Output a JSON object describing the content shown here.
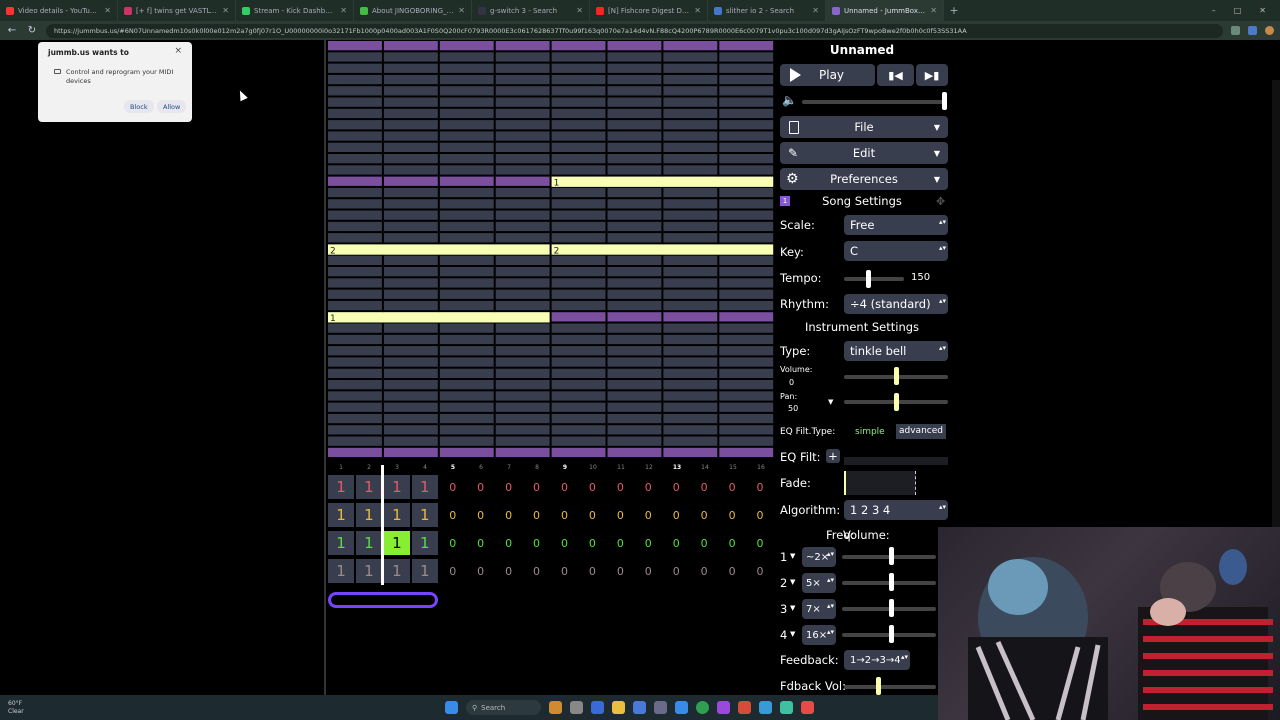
{
  "browser": {
    "tabs": [
      {
        "title": "Video details - YouTube Studio",
        "color": "#ff3333"
      },
      {
        "title": "[+ f] twins get VASTLY JUMPSCARE",
        "color": "#cc3366"
      },
      {
        "title": "Stream - Kick Dashboard",
        "color": "#33cc66"
      },
      {
        "title": "About JINGOBORING_TWINS - Kick",
        "color": "#44bb44"
      },
      {
        "title": "g-switch 3 - Search",
        "color": "#333344"
      },
      {
        "title": "[N] Fishcore Digest Day 1 - GLOVE",
        "color": "#ff2222"
      },
      {
        "title": "slither io 2 - Search",
        "color": "#4477cc"
      },
      {
        "title": "Unnamed - JummBox 2.6",
        "color": "#8866cc"
      }
    ],
    "new_tab": "+",
    "window_controls": [
      "–",
      "□",
      "✕"
    ],
    "url": "https://jummbus.us/#6N07Unnamedm10s0k0l00e012m2a7g0fj07r1O_U00000000i0o32171Fb1000p0400ad003A1F0S0Q200cF0793R0000E3c0617628637Tf0u99f163q0070e7a14d4vN.F88cQ4200P6789R0000E6c0079T1v0pu3c100d097d3gAIjsOzFT9wpoBwe2f0b0h0c0f53SS31AA"
  },
  "popup": {
    "title": "jummb.us wants to",
    "close": "×",
    "message": "Control and reprogram your MIDI devices",
    "block_label": "Block",
    "allow_label": "Allow"
  },
  "pattern": {
    "notes_upper": [
      {
        "label": "1"
      },
      {
        "label": "2"
      },
      {
        "label": "2"
      },
      {
        "label": "1"
      }
    ],
    "bar_numbers": [
      "1",
      "2",
      "3",
      "4",
      "5",
      "6",
      "7",
      "8",
      "9",
      "10",
      "11",
      "12",
      "13",
      "14",
      "15",
      "16"
    ],
    "bar_highlight": [
      "5",
      "9",
      "13"
    ]
  },
  "tracks": {
    "rows": [
      {
        "color": "#e05a6a",
        "cells": [
          "1",
          "1",
          "1",
          "1",
          "0",
          "0",
          "0",
          "0",
          "0",
          "0",
          "0",
          "0",
          "0",
          "0",
          "0",
          "0"
        ]
      },
      {
        "color": "#e8b840",
        "cells": [
          "1",
          "1",
          "1",
          "1",
          "0",
          "0",
          "0",
          "0",
          "0",
          "0",
          "0",
          "0",
          "0",
          "0",
          "0",
          "0"
        ]
      },
      {
        "color": "#55dd44",
        "cells": [
          "1",
          "1",
          "1",
          "1",
          "0",
          "0",
          "0",
          "0",
          "0",
          "0",
          "0",
          "0",
          "0",
          "0",
          "0",
          "0"
        ]
      },
      {
        "color": "#9a8a8a",
        "cells": [
          "1",
          "1",
          "1",
          "1",
          "0",
          "0",
          "0",
          "0",
          "0",
          "0",
          "0",
          "0",
          "0",
          "0",
          "0",
          "0"
        ]
      }
    ]
  },
  "panel": {
    "song_title": "Unnamed",
    "play_label": "Play",
    "file_label": "File",
    "edit_label": "Edit",
    "preferences_label": "Preferences",
    "song_settings_label": "Song Settings",
    "song_settings_badge": "1",
    "scale_label": "Scale:",
    "scale_value": "Free",
    "key_label": "Key:",
    "key_value": "C",
    "tempo_label": "Tempo:",
    "tempo_value": "150",
    "rhythm_label": "Rhythm:",
    "rhythm_value": "÷4 (standard)",
    "instrument_settings_label": "Instrument Settings",
    "type_label": "Type:",
    "type_value": "tinkle bell",
    "volume_label": "Volume:",
    "volume_value": "0",
    "pan_label": "Pan:",
    "pan_value": "50",
    "eq_filt_type_label": "EQ Filt.Type:",
    "eq_simple": "simple",
    "eq_advanced": "advanced",
    "eq_filt_label": "EQ Filt:",
    "eq_plus": "+",
    "fade_label": "Fade:",
    "algorithm_label": "Algorithm:",
    "algorithm_value": "1  2  3  4",
    "freq_label": "Freq:",
    "op_volume_label": "Volume:",
    "operators": [
      {
        "num": "1",
        "freq": "~2×"
      },
      {
        "num": "2",
        "freq": "5×"
      },
      {
        "num": "3",
        "freq": "7×"
      },
      {
        "num": "4",
        "freq": "16×"
      }
    ],
    "feedback_label": "Feedback:",
    "feedback_value": "1→2→3→4",
    "fdback_vol_label": "Fdback Vol:"
  },
  "taskbar": {
    "weather_temp": "60°F",
    "weather_desc": "Clear",
    "search_placeholder": "Search"
  }
}
